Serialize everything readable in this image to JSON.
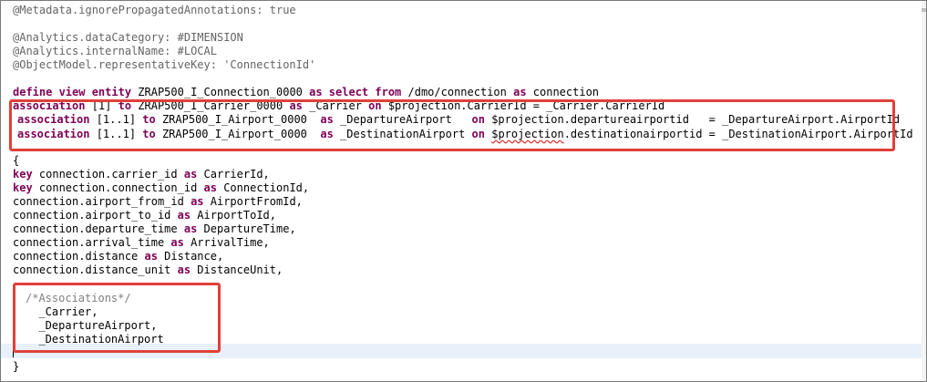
{
  "editor": {
    "lines": {
      "meta": "@Metadata.ignorePropagatedAnnotations: true",
      "dc": "@Analytics.dataCategory: #DIMENSION",
      "iname": "@Analytics.internalName: #LOCAL",
      "rkey": "@ObjectModel.representativeKey: 'ConnectionId'",
      "def_kw": "define view entity",
      "def_name": " ZRAP500_I_Connection_0000 ",
      "def_as": "as select from",
      "def_src": " /dmo/connection ",
      "def_as2": "as",
      "def_alias": " connection",
      "assoc": "association",
      "card1": " [1] ",
      "card11": " [1..1] ",
      "to": "to",
      "as": "as",
      "on": "on",
      "a1_target": " ZRAP500_I_Carrier_0000 ",
      "a1_alias": " _Carrier ",
      "a1_cond": " $projection.CarrierId = _Carrier.CarrierId",
      "a2_target": " ZRAP500_I_Airport_0000  ",
      "a2_alias": " _DepartureAirport   ",
      "a2_cond": " $projection.departureairportid   = _DepartureAirport.AirportId",
      "a3_target": " ZRAP500_I_Airport_0000  ",
      "a3_alias": " _DestinationAirport ",
      "a3_cond_pre": " ",
      "a3_cond_sq": "$projection",
      "a3_cond_post": ".destinationairportid = _DestinationAirport.AirportId",
      "brace_open": "{",
      "key": "key",
      "f1": " connection.carrier_id ",
      "f1_alias": " CarrierId,",
      "f2": " connection.connection_id ",
      "f2_alias": " ConnectionId,",
      "f3": "connection.airport_from_id ",
      "f3_alias": " AirportFromId,",
      "f4": "connection.airport_to_id ",
      "f4_alias": " AirportToId,",
      "f5": "connection.departure_time ",
      "f5_alias": " DepartureTime,",
      "f6": "connection.arrival_time ",
      "f6_alias": " ArrivalTime,",
      "f7": "connection.distance ",
      "f7_alias": " Distance,",
      "f8": "connection.distance_unit ",
      "f8_alias": " DistanceUnit,",
      "comment": "/*Associations*/",
      "e1": "  _Carrier,",
      "e2": "  _DepartureAirport,",
      "e3": "  _DestinationAirport",
      "brace_close": "}"
    }
  },
  "colors": {
    "keyword": "#7f0055",
    "annotation": "#646464",
    "literal": "#2a00ff",
    "highlight_box": "#e0403a",
    "current_line": "#e8f0fa"
  }
}
